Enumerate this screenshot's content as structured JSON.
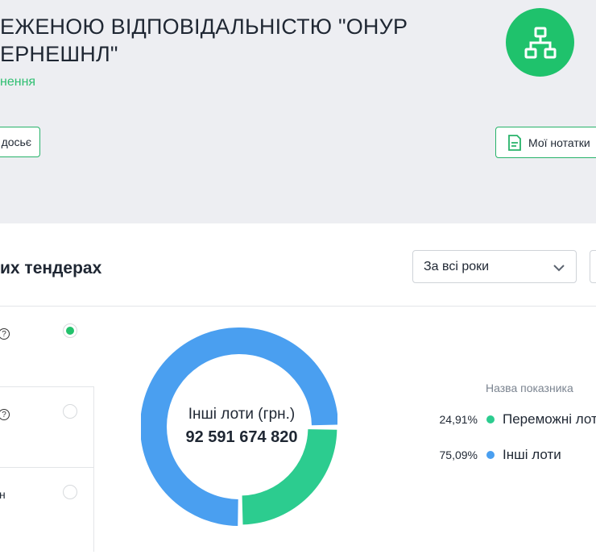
{
  "company": {
    "title": "ЕЖЕНОЮ ВІДПОВІДАЛЬНІСТЮ \"ОНУР\nЕРНЕШНЛ\"",
    "subtitle": "нення"
  },
  "buttons": {
    "dossier": "досьє",
    "notes": "Мої нотатки"
  },
  "section": {
    "title": "их тендерах"
  },
  "filters": {
    "year_selected": "За всі роки"
  },
  "options": [
    {
      "label": "",
      "selected": true
    },
    {
      "label": "",
      "selected": false
    },
    {
      "label": "н",
      "selected": false
    }
  ],
  "chart_data": {
    "type": "pie",
    "style": "donut",
    "center_label": "Інші лоти (грн.)",
    "center_value": "92 591 674 820",
    "legend_title": "Назва показника",
    "slices": [
      {
        "name": "Переможні лоти",
        "percent_label": "24,91%",
        "value": 24.91,
        "color": "#2ccc8f"
      },
      {
        "name": "Інші лоти",
        "percent_label": "75,09%",
        "value": 75.09,
        "color": "#4a9ff0"
      }
    ]
  }
}
